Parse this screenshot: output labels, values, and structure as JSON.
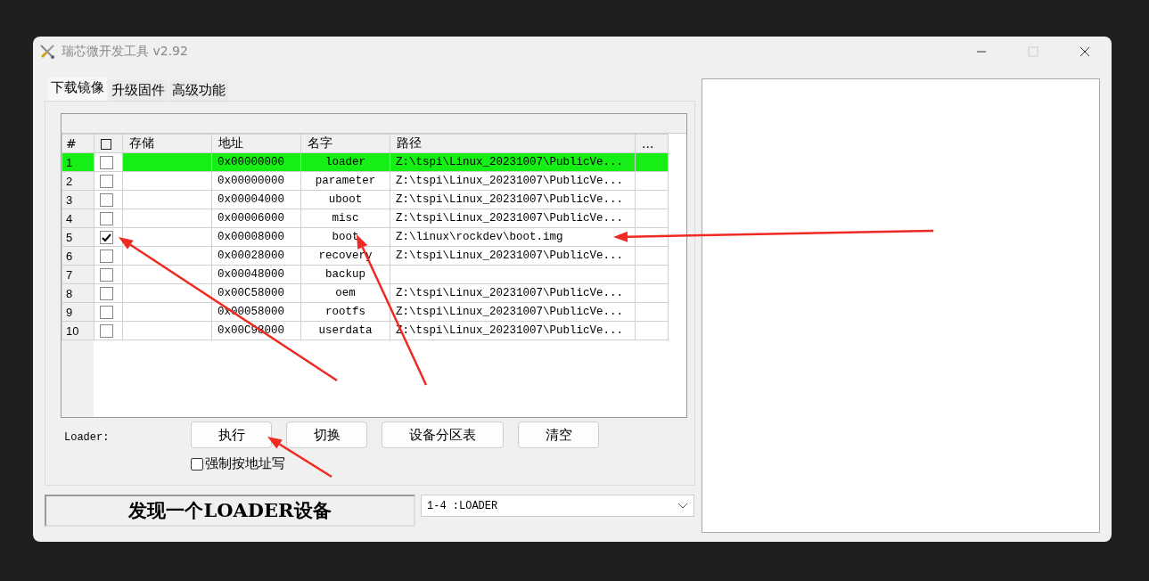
{
  "window": {
    "title": "瑞芯微开发工具 v2.92"
  },
  "tabs": [
    {
      "label": "下载镜像",
      "selected": true
    },
    {
      "label": "升级固件",
      "selected": false
    },
    {
      "label": "高级功能",
      "selected": false
    }
  ],
  "table": {
    "columns": [
      {
        "kind": "text",
        "label": "#"
      },
      {
        "kind": "checkbox",
        "checked": false
      },
      {
        "kind": "text",
        "label": "存储"
      },
      {
        "kind": "text",
        "label": "地址"
      },
      {
        "kind": "text",
        "label": "名字"
      },
      {
        "kind": "text",
        "label": "路径"
      },
      {
        "kind": "text",
        "label": "..."
      }
    ],
    "rows": [
      {
        "number": "1",
        "checked": false,
        "address": "0x00000000",
        "name": "loader",
        "path": "Z:\\tspi\\Linux_20231007\\PublicVe...",
        "selected": true
      },
      {
        "number": "2",
        "checked": false,
        "address": "0x00000000",
        "name": "parameter",
        "path": "Z:\\tspi\\Linux_20231007\\PublicVe...",
        "selected": false
      },
      {
        "number": "3",
        "checked": false,
        "address": "0x00004000",
        "name": "uboot",
        "path": "Z:\\tspi\\Linux_20231007\\PublicVe...",
        "selected": false
      },
      {
        "number": "4",
        "checked": false,
        "address": "0x00006000",
        "name": "misc",
        "path": "Z:\\tspi\\Linux_20231007\\PublicVe...",
        "selected": false
      },
      {
        "number": "5",
        "checked": true,
        "address": "0x00008000",
        "name": "boot",
        "path": "Z:\\linux\\rockdev\\boot.img",
        "selected": false
      },
      {
        "number": "6",
        "checked": false,
        "address": "0x00028000",
        "name": "recovery",
        "path": "Z:\\tspi\\Linux_20231007\\PublicVe...",
        "selected": false
      },
      {
        "number": "7",
        "checked": false,
        "address": "0x00048000",
        "name": "backup",
        "selected": false
      },
      {
        "number": "8",
        "checked": false,
        "address": "0x00C58000",
        "name": "oem",
        "path": "Z:\\tspi\\Linux_20231007\\PublicVe...",
        "selected": false
      },
      {
        "number": "9",
        "checked": false,
        "address": "0x00058000",
        "name": "rootfs",
        "path": "Z:\\tspi\\Linux_20231007\\PublicVe...",
        "selected": false
      },
      {
        "number": "10",
        "checked": false,
        "address": "0x00C98000",
        "name": "userdata",
        "path": "Z:\\tspi\\Linux_20231007\\PublicVe...",
        "selected": false
      }
    ]
  },
  "loader_label": "Loader:",
  "buttons": [
    "执行",
    "切换",
    "设备分区表",
    "清空"
  ],
  "force_address_write": {
    "label": "强制按地址写",
    "checked": false
  },
  "status_message": "发现一个LOADER设备",
  "device_select": {
    "value": "1-4 :LOADER"
  }
}
